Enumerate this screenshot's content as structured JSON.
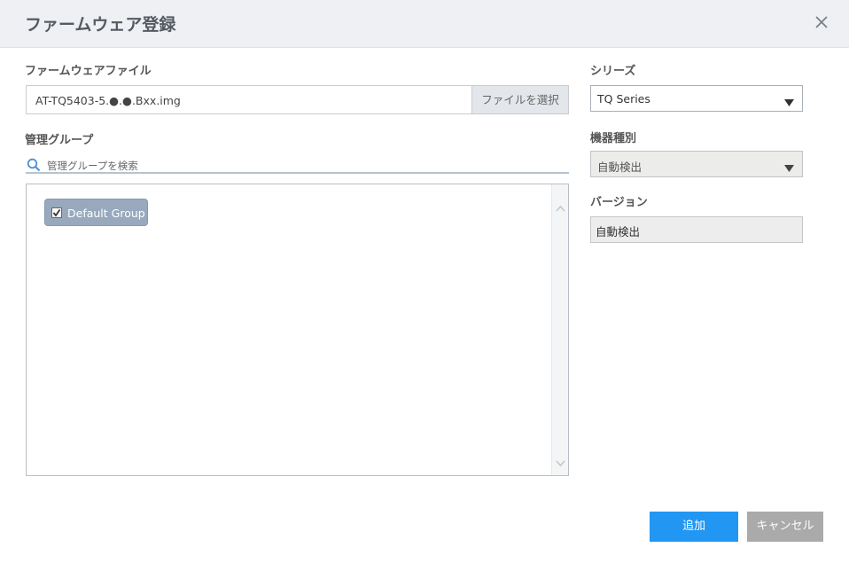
{
  "dialog": {
    "title": "ファームウェア登録"
  },
  "firmware_file": {
    "label": "ファームウェアファイル",
    "value": "AT-TQ5403-5.●.●.Bxx.img",
    "browse_label": "ファイルを選択"
  },
  "management_group": {
    "label": "管理グループ",
    "search_placeholder": "管理グループを検索",
    "groups": [
      {
        "label": "Default Group",
        "checked": true
      }
    ]
  },
  "series": {
    "label": "シリーズ",
    "value": "TQ Series"
  },
  "device_type": {
    "label": "機器種別",
    "value": "自動検出"
  },
  "version": {
    "label": "バージョン",
    "value": "自動検出"
  },
  "buttons": {
    "add": "追加",
    "cancel": "キャンセル"
  },
  "colors": {
    "primary": "#2196f3",
    "secondary": "#aaaaaa",
    "chip": "#98a9bd",
    "header_bg": "#eef0f4"
  },
  "icons": {
    "close": "close-icon",
    "search": "search-icon",
    "dropdown": "caret-down-icon",
    "scroll_up": "chevron-up-icon",
    "scroll_down": "chevron-down-icon",
    "check": "checkbox-checked-icon"
  }
}
